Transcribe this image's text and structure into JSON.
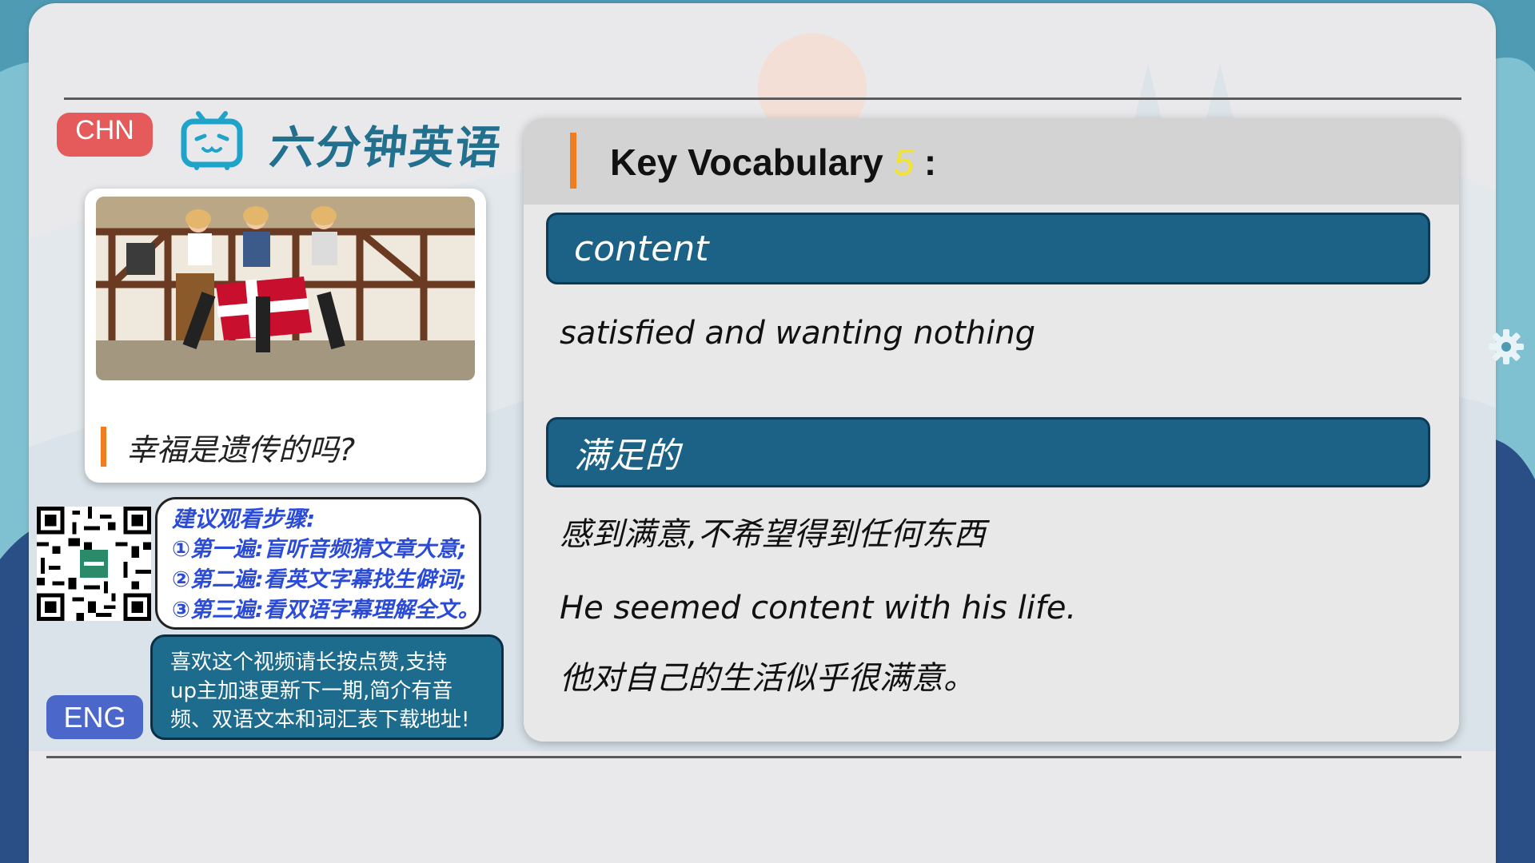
{
  "lang_badges": {
    "chn": "CHN",
    "eng": "ENG"
  },
  "brand": {
    "title": "六分钟英语",
    "icon": "bilibili-tv-icon"
  },
  "episode": {
    "caption": "幸福是遗传的吗?"
  },
  "steps": {
    "title": "建议观看步骤:",
    "items": [
      "①第一遍:盲听音频猜文章大意;",
      "②第二遍:看英文字幕找生僻词;",
      "③第三遍:看双语字幕理解全文。"
    ]
  },
  "promo": {
    "lines": [
      "喜欢这个视频请长按点赞,支持",
      "up主加速更新下一期,简介有音",
      "频、双语文本和词汇表下载地址!"
    ]
  },
  "vocab": {
    "heading": "Key Vocabulary",
    "number": "5",
    "colon": ":",
    "word": "content",
    "definition_en": "satisfied and wanting nothing",
    "word_cn": "满足的",
    "definition_cn": "感到满意,不希望得到任何东西",
    "example_en": "He seemed content with his life.",
    "example_cn": "他对自己的生活似乎很满意。"
  },
  "colors": {
    "accent_orange": "#f07d20",
    "word_bar": "#1b6286",
    "brand_teal": "#23708e",
    "chn_badge": "#e55a5a",
    "eng_badge": "#4a67c9"
  }
}
